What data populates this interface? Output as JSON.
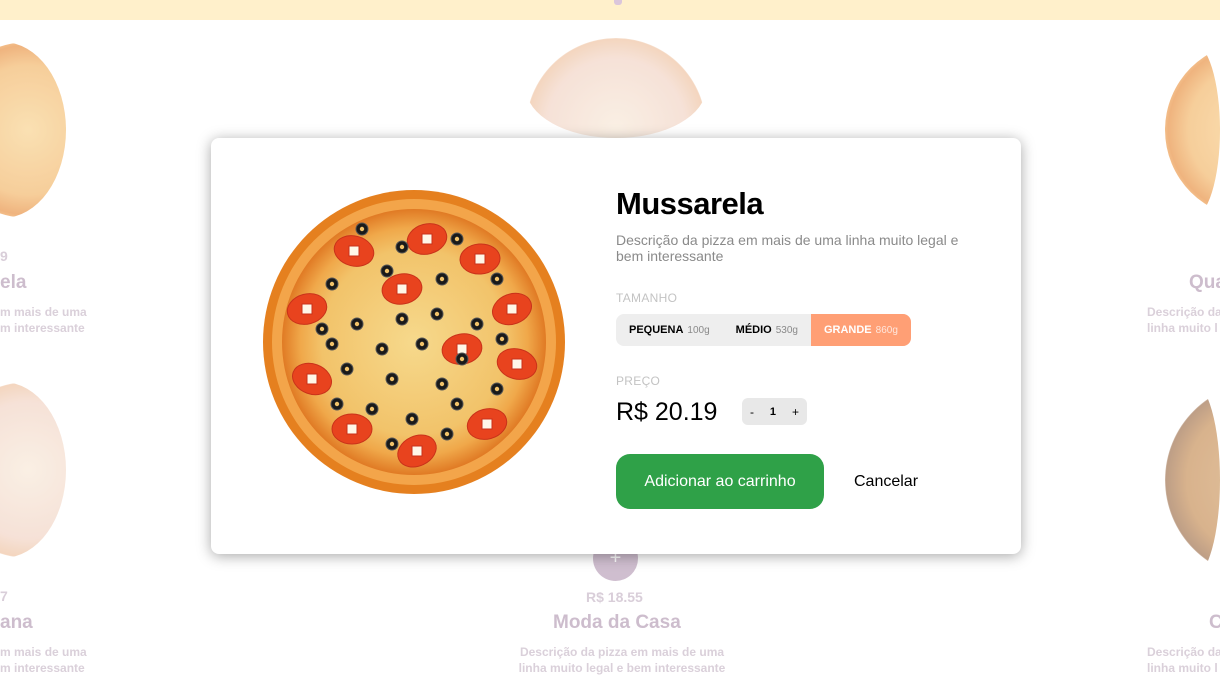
{
  "background": {
    "cards": [
      {
        "price": "9",
        "name": "ela",
        "desc": "m mais de uma\nm interessante"
      },
      {
        "price": "7",
        "name": "ana",
        "desc": "m mais de uma\nm interessante"
      },
      {
        "price": "",
        "name": "Qua",
        "desc": "Descrição da\nlinha muito l"
      },
      {
        "price": "",
        "name": "C",
        "desc": "Descrição da\nlinha muito l"
      },
      {
        "price": "R$ 18.55",
        "name": "Moda da Casa",
        "desc": "Descrição da pizza em mais de uma\nlinha muito legal e bem interessante"
      }
    ],
    "add_symbol": "+"
  },
  "modal": {
    "title": "Mussarela",
    "description": "Descrição da pizza em mais de uma linha muito legal e bem interessante",
    "size_label": "TAMANHO",
    "sizes": [
      {
        "name": "PEQUENA",
        "weight": "100g"
      },
      {
        "name": "MÉDIO",
        "weight": "530g"
      },
      {
        "name": "GRANDE",
        "weight": "860g"
      }
    ],
    "selected_size": "GRANDE",
    "price_label": "PREÇO",
    "price": "R$ 20.19",
    "qty_minus": "-",
    "qty_value": "1",
    "qty_plus": "+",
    "add_to_cart": "Adicionar ao carrinho",
    "cancel": "Cancelar"
  },
  "colors": {
    "accent": "#ff9f75",
    "add_button": "#2fa148",
    "topbar": "#ffe9b0",
    "bg_text": "#b39ab2"
  }
}
